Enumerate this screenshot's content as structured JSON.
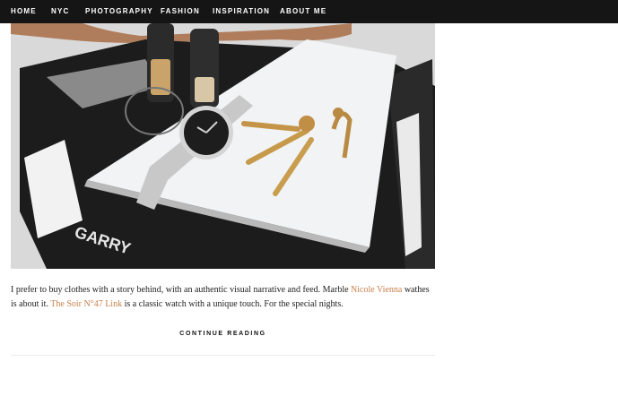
{
  "nav": {
    "items": [
      {
        "label": "HOME"
      },
      {
        "label": "NYC"
      },
      {
        "label": "PHOTOGRAPHY"
      },
      {
        "label": "FASHION"
      },
      {
        "label": "INSPIRATION"
      },
      {
        "label": "ABOUT ME"
      }
    ]
  },
  "hero": {
    "book_text": "GARRY"
  },
  "post": {
    "text_1": "I prefer to buy clothes with a story behind, with an authentic visual narrative and feed. Marble ",
    "link_1": "Nicole Vienna",
    "text_2": " wathes is about it. ",
    "link_2": "The Soir N°47 Link",
    "text_3": " is a classic watch with a unique touch. For the special nights.",
    "continue_label": "CONTINUE READING"
  },
  "colors": {
    "nav_background": "#151515",
    "link": "#c8804b"
  }
}
